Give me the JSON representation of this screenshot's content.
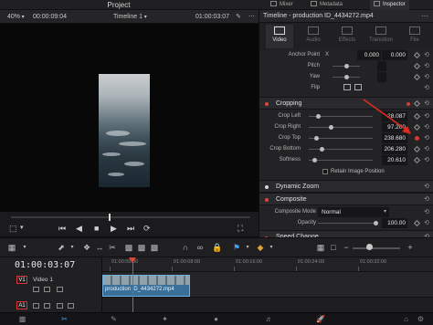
{
  "app": {
    "project_title": "Project",
    "top_tabs": [
      {
        "label": "Mixer",
        "icon": "mixer-icon"
      },
      {
        "label": "Metadata",
        "icon": "metadata-icon"
      },
      {
        "label": "Inspector",
        "icon": "inspector-icon",
        "active": true
      }
    ]
  },
  "viewer": {
    "zoom": "40%",
    "source_timecode": "00:00:09:04",
    "timeline_name": "Timeline 1",
    "record_timecode": "01:00:03:07",
    "playback_progress": 0.41
  },
  "inspector": {
    "title": "Timeline - production ID_4434272.mp4",
    "tabs": [
      {
        "label": "Video",
        "icon": "video-icon",
        "active": true
      },
      {
        "label": "Audio",
        "icon": "audio-icon"
      },
      {
        "label": "Effects",
        "icon": "effects-icon"
      },
      {
        "label": "Transition",
        "icon": "transition-icon"
      },
      {
        "label": "File",
        "icon": "file-icon"
      }
    ],
    "transform": {
      "anchor_point_label": "Anchor Point",
      "anchor_x_label": "X",
      "anchor_x": "0.000",
      "anchor_y_label": "Y",
      "anchor_y": "0.000",
      "pitch_label": "Pitch",
      "yaw_label": "Yaw",
      "flip_label": "Flip"
    },
    "cropping": {
      "section": "Cropping",
      "rows": [
        {
          "label": "Crop Left",
          "value": "28.087"
        },
        {
          "label": "Crop Right",
          "value": "97.200"
        },
        {
          "label": "Crop Top",
          "value": "238.680"
        },
        {
          "label": "Crop Bottom",
          "value": "206.280"
        },
        {
          "label": "Softness",
          "value": "20.610"
        }
      ],
      "retain_label": "Retain Image Position"
    },
    "dynamic_zoom": {
      "section": "Dynamic Zoom"
    },
    "composite": {
      "section": "Composite",
      "mode_label": "Composite Mode",
      "mode_value": "Normal",
      "opacity_label": "Opacity",
      "opacity_value": "100.00"
    },
    "speed_change": {
      "section": "Speed Change"
    }
  },
  "timeline": {
    "timecode": "01:00:03:07",
    "video_track_id": "V1",
    "video_track_name": "Video 1",
    "audio_track_id": "A1",
    "clip_name": "production ID_4434272.mp4",
    "ruler_labels": [
      "01:00:00:00",
      "01:00:08:00",
      "01:00:16:00",
      "01:00:24:00",
      "01:00:32:00"
    ]
  },
  "colors": {
    "accent_red": "#e0473c",
    "clip_blue": "#3a6f9a",
    "page_active": "#4aa3e8"
  }
}
